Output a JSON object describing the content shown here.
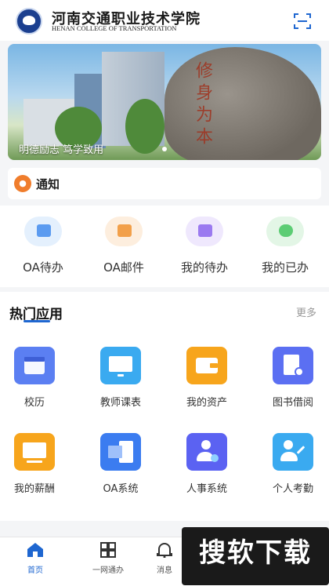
{
  "header": {
    "title_cn": "河南交通职业技术学院",
    "title_en": "HENAN COLLEGE OF TRANSPORTATION",
    "scan_icon": "scan-icon"
  },
  "banner": {
    "caption": "明德励志 笃学致用",
    "rock_text": "修身为本"
  },
  "notice": {
    "label": "通知",
    "icon": "megaphone-icon"
  },
  "quick_actions": [
    {
      "label": "OA待办",
      "icon": "folder-icon",
      "color": "#5b9bf0"
    },
    {
      "label": "OA邮件",
      "icon": "mail-icon",
      "color": "#f2a04a"
    },
    {
      "label": "我的待办",
      "icon": "document-icon",
      "color": "#9b7af0"
    },
    {
      "label": "我的已办",
      "icon": "chat-icon",
      "color": "#5ccd74"
    }
  ],
  "apps": {
    "title": "热门应用",
    "more": "更多",
    "items": [
      {
        "label": "校历",
        "icon": "calendar-icon",
        "color": "#5b7ff2"
      },
      {
        "label": "教师课表",
        "icon": "screen-icon",
        "color": "#3aaaf0"
      },
      {
        "label": "我的资产",
        "icon": "wallet-icon",
        "color": "#f7a51c"
      },
      {
        "label": "图书借阅",
        "icon": "book-clock-icon",
        "color": "#5b6ff2"
      },
      {
        "label": "我的薪酬",
        "icon": "salary-icon",
        "color": "#f7a51c"
      },
      {
        "label": "OA系统",
        "icon": "oa-doc-icon",
        "color": "#3b7cf0"
      },
      {
        "label": "人事系统",
        "icon": "person-check-icon",
        "color": "#5b62f2"
      },
      {
        "label": "个人考勤",
        "icon": "attendance-icon",
        "color": "#3aaaf0"
      }
    ]
  },
  "tabbar": [
    {
      "label": "首页",
      "icon": "home-icon",
      "active": true
    },
    {
      "label": "一网通办",
      "icon": "grid-icon",
      "active": false
    },
    {
      "label": "消息",
      "icon": "bell-icon",
      "active": false
    }
  ],
  "watermark": "搜软下载"
}
